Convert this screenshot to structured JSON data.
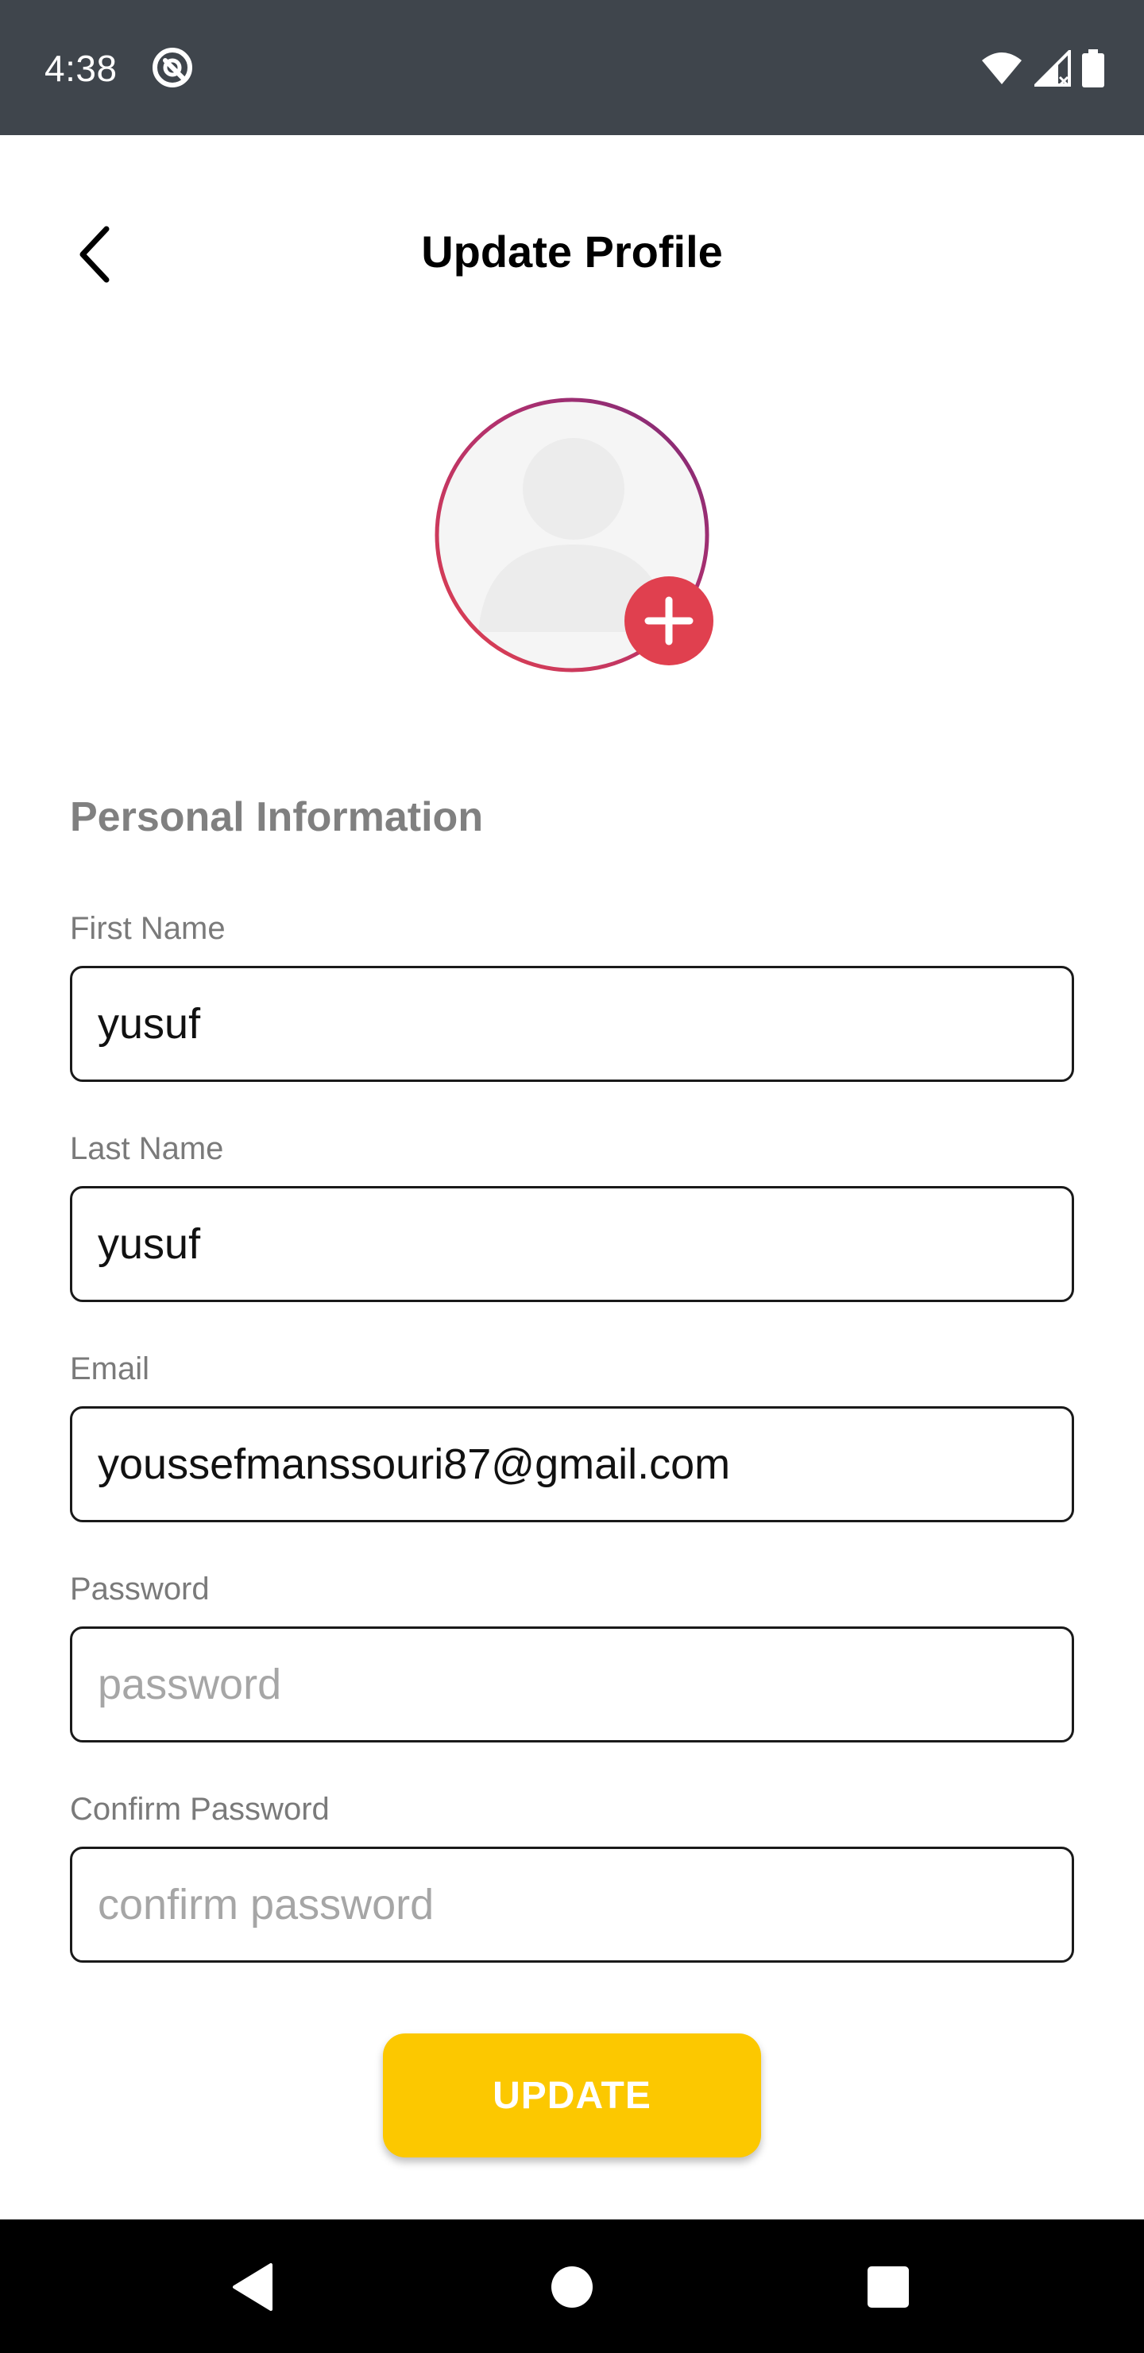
{
  "status_bar": {
    "time": "4:38",
    "app_icon": "at-sign-icon",
    "icons": [
      "wifi-icon",
      "signal-icon",
      "battery-icon"
    ]
  },
  "header": {
    "title": "Update Profile",
    "back_icon": "chevron-left-icon"
  },
  "avatar": {
    "placeholder_icon": "user-silhouette-icon",
    "add_icon": "plus-icon",
    "ring_colors": [
      "#e0404f",
      "#b0306e",
      "#7a2a78"
    ],
    "add_button_color": "#e0404f"
  },
  "section": {
    "title": "Personal Information"
  },
  "form": {
    "first_name": {
      "label": "First Name",
      "value": "yusuf",
      "placeholder": ""
    },
    "last_name": {
      "label": "Last Name",
      "value": "yusuf",
      "placeholder": ""
    },
    "email": {
      "label": "Email",
      "value": "youssefmanssouri87@gmail.com",
      "placeholder": ""
    },
    "password": {
      "label": "Password",
      "value": "",
      "placeholder": "password"
    },
    "confirm_password": {
      "label": "Confirm Password",
      "value": "",
      "placeholder": "confirm password"
    }
  },
  "actions": {
    "update_label": "UPDATE",
    "update_color": "#fcc800"
  },
  "nav_bar": {
    "icons": [
      "back-triangle-icon",
      "home-circle-icon",
      "recents-square-icon"
    ]
  }
}
